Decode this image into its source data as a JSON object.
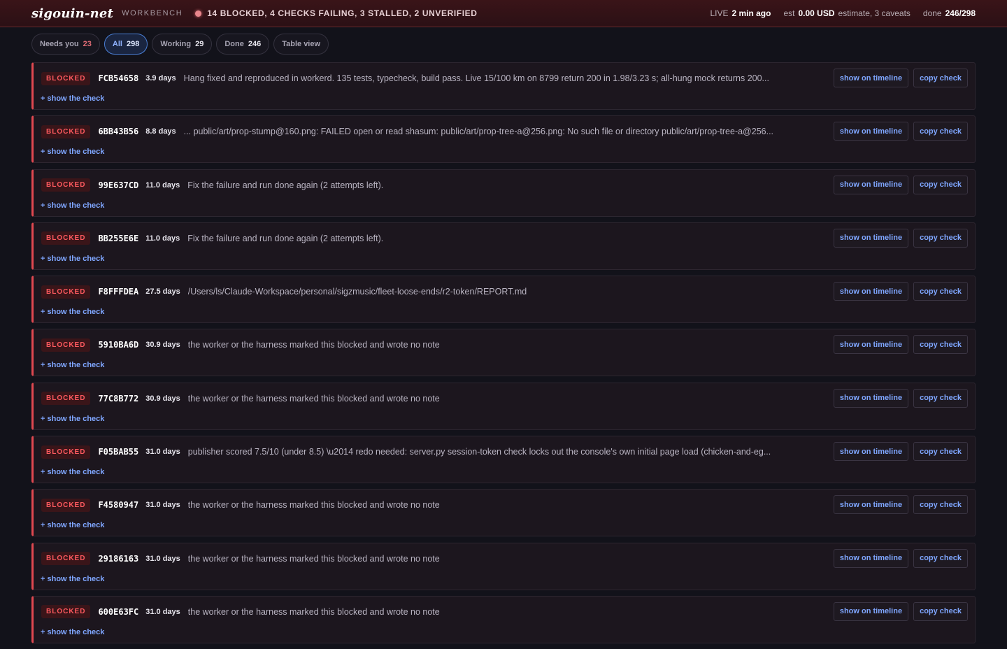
{
  "header": {
    "brand": "sigouin-net",
    "subtitle": "WORKBENCH",
    "alert": "14 BLOCKED, 4 CHECKS FAILING, 3 STALLED, 2 UNVERIFIED",
    "live_label": "LIVE",
    "live_value": "2 min ago",
    "est_label": "est",
    "est_value": "0.00 USD",
    "est_note": "estimate, 3 caveats",
    "done_label": "done",
    "done_value": "246/298"
  },
  "filters": [
    {
      "label": "Needs you",
      "count": "23",
      "active": false,
      "count_color": "#e06c75"
    },
    {
      "label": "All",
      "count": "298",
      "active": true
    },
    {
      "label": "Working",
      "count": "29",
      "active": false
    },
    {
      "label": "Done",
      "count": "246",
      "active": false
    },
    {
      "label": "Table view",
      "count": "",
      "active": false
    }
  ],
  "row_labels": {
    "badge": "BLOCKED",
    "show_timeline": "show on timeline",
    "copy_check": "copy check",
    "show_check": "+ show the check"
  },
  "colors": {
    "blocked": "#e04850",
    "link": "#7fa6ff",
    "accent": "#4a7fd6"
  },
  "rows": [
    {
      "id": "FCB54658",
      "age": "3.9 days",
      "msg": "Hang fixed and reproduced in workerd. 135 tests, typecheck, build pass. Live 15/100 km on 8799 return 200 in 1.98/3.23 s; all-hung mock returns 200..."
    },
    {
      "id": "6BB43B56",
      "age": "8.8 days",
      "msg": "... public/art/prop-stump@160.png: FAILED open or read shasum: public/art/prop-tree-a@256.png: No such file or directory public/art/prop-tree-a@256..."
    },
    {
      "id": "99E637CD",
      "age": "11.0 days",
      "msg": "Fix the failure and run done again (2 attempts left)."
    },
    {
      "id": "BB255E6E",
      "age": "11.0 days",
      "msg": "Fix the failure and run done again (2 attempts left)."
    },
    {
      "id": "F8FFFDEA",
      "age": "27.5 days",
      "msg": "/Users/ls/Claude-Workspace/personal/sigzmusic/fleet-loose-ends/r2-token/REPORT.md"
    },
    {
      "id": "5910BA6D",
      "age": "30.9 days",
      "msg": "the worker or the harness marked this blocked and wrote no note"
    },
    {
      "id": "77C8B772",
      "age": "30.9 days",
      "msg": "the worker or the harness marked this blocked and wrote no note"
    },
    {
      "id": "F05BAB55",
      "age": "31.0 days",
      "msg": "publisher scored 7.5/10 (under 8.5) \\u2014 redo needed: server.py session-token check locks out the console's own initial page load (chicken-and-eg..."
    },
    {
      "id": "F4580947",
      "age": "31.0 days",
      "msg": "the worker or the harness marked this blocked and wrote no note"
    },
    {
      "id": "29186163",
      "age": "31.0 days",
      "msg": "the worker or the harness marked this blocked and wrote no note"
    },
    {
      "id": "600E63FC",
      "age": "31.0 days",
      "msg": "the worker or the harness marked this blocked and wrote no note"
    }
  ]
}
